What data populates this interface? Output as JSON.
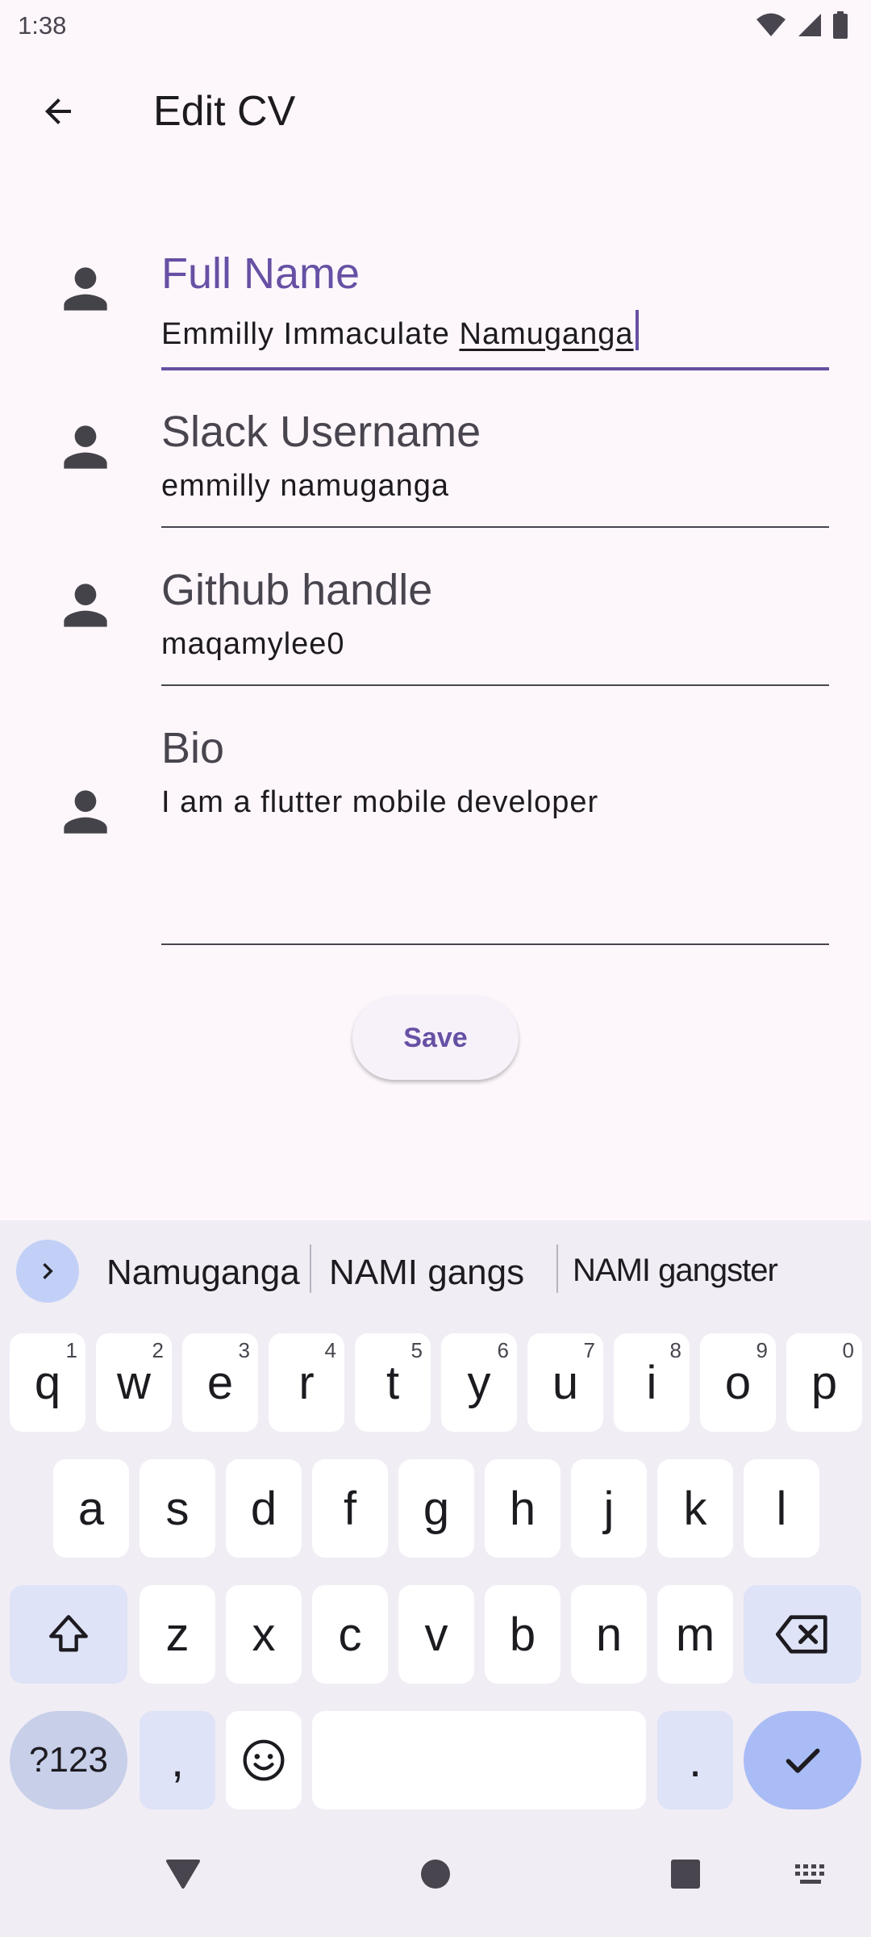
{
  "status_bar": {
    "time": "1:38"
  },
  "app_bar": {
    "title": "Edit CV"
  },
  "form": {
    "full_name": {
      "label": "Full Name",
      "value_prefix": "Emmilly Immaculate ",
      "value_composing": "Namuganga"
    },
    "slack": {
      "label": "Slack Username",
      "value": "emmilly namuganga"
    },
    "github": {
      "label": "Github handle",
      "value": "maqamylee0"
    },
    "bio": {
      "label": "Bio",
      "value": "I am a flutter mobile developer"
    },
    "save_label": "Save"
  },
  "keyboard": {
    "suggestions": [
      "Namuganga",
      "NAMI gangs",
      "NAMI gangster"
    ],
    "row1": [
      {
        "k": "q",
        "h": "1"
      },
      {
        "k": "w",
        "h": "2"
      },
      {
        "k": "e",
        "h": "3"
      },
      {
        "k": "r",
        "h": "4"
      },
      {
        "k": "t",
        "h": "5"
      },
      {
        "k": "y",
        "h": "6"
      },
      {
        "k": "u",
        "h": "7"
      },
      {
        "k": "i",
        "h": "8"
      },
      {
        "k": "o",
        "h": "9"
      },
      {
        "k": "p",
        "h": "0"
      }
    ],
    "row2": [
      "a",
      "s",
      "d",
      "f",
      "g",
      "h",
      "j",
      "k",
      "l"
    ],
    "row3": [
      "z",
      "x",
      "c",
      "v",
      "b",
      "n",
      "m"
    ],
    "symbols_label": "?123",
    "comma": ",",
    "period": "."
  },
  "colors": {
    "accent": "#6750a4",
    "background": "#fdf7fc",
    "keyboard_bg": "#f1edf5"
  },
  "icons": [
    "back-arrow-icon",
    "person-icon",
    "wifi-icon",
    "signal-icon",
    "battery-icon",
    "chevron-right-icon",
    "shift-icon",
    "backspace-icon",
    "emoji-icon",
    "check-icon",
    "nav-back-icon",
    "nav-home-icon",
    "nav-recents-icon",
    "keyboard-switch-icon"
  ]
}
